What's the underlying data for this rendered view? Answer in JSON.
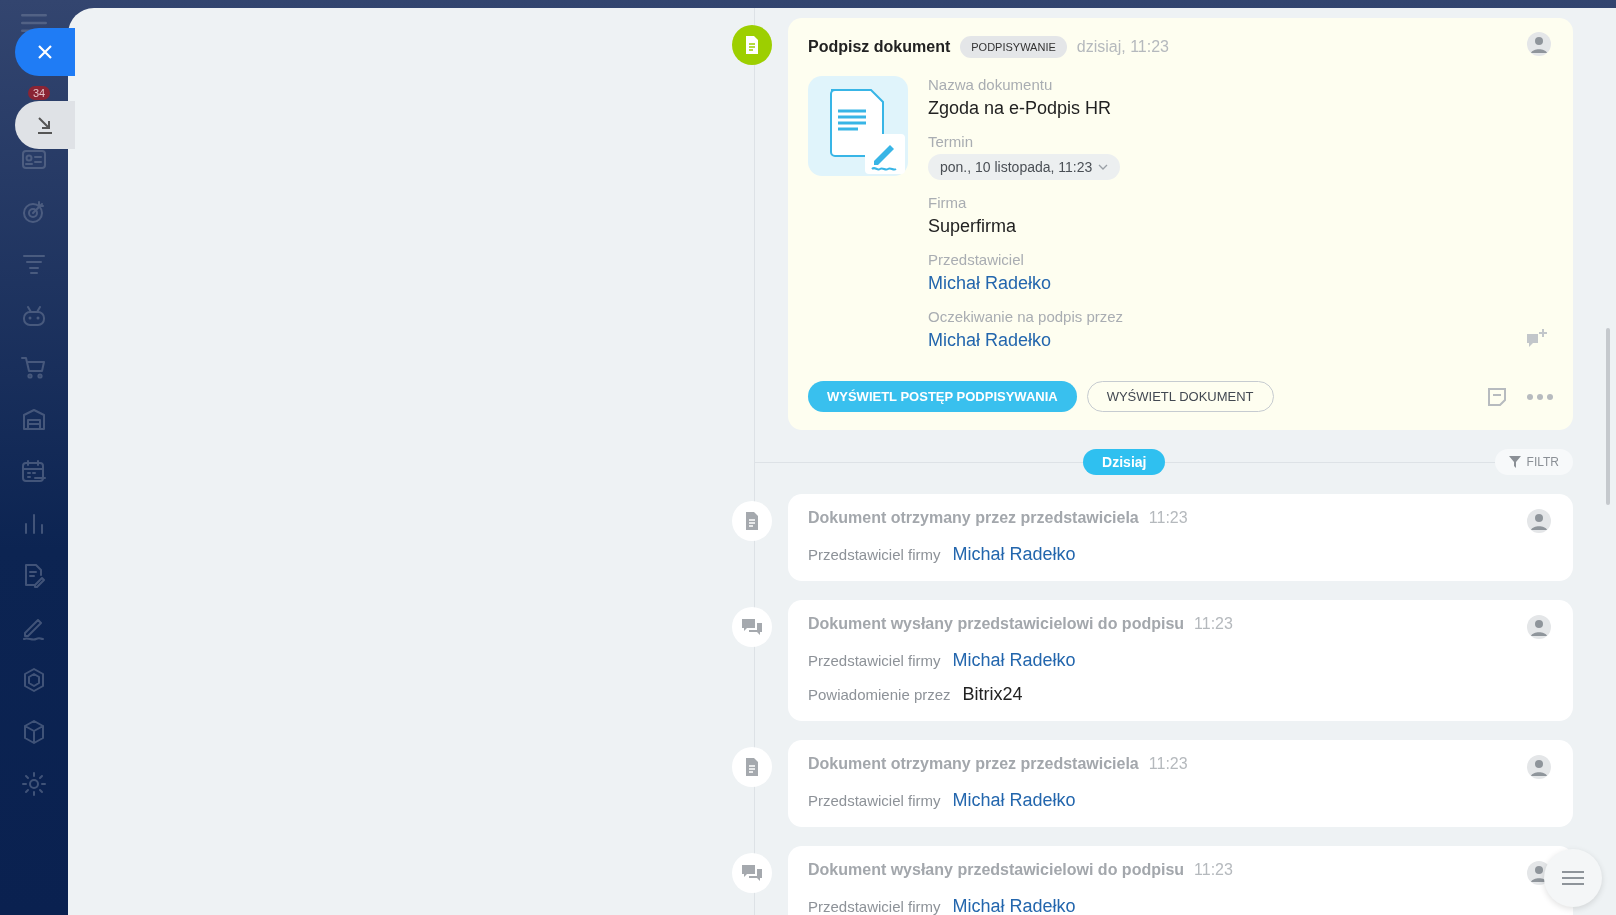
{
  "sidebar": {
    "badge": "34"
  },
  "main_card": {
    "title": "Podpisz dokument",
    "status": "PODPISYWANIE",
    "time": "dzisiaj, 11:23",
    "fields": [
      {
        "label": "Nazwa dokumentu",
        "value": "Zgoda na e-Podpis HR",
        "kind": "text"
      },
      {
        "label": "Termin",
        "value": "pon., 10 listopada, 11:23",
        "kind": "dropdown"
      },
      {
        "label": "Firma",
        "value": "Superfirma",
        "kind": "text"
      },
      {
        "label": "Przedstawiciel",
        "value": "Michał Radełko",
        "kind": "link"
      },
      {
        "label": "Oczekiwanie na podpis przez",
        "value": "Michał Radełko",
        "kind": "link"
      }
    ],
    "buttons": [
      {
        "label": "WYŚWIETL POSTĘP PODPISYWANIA",
        "kind": "primary"
      },
      {
        "label": "WYŚWIETL DOKUMENT",
        "kind": "outline"
      }
    ]
  },
  "divider": {
    "label": "Dzisiaj",
    "filter": "FILTR"
  },
  "events": [
    {
      "kind": "document",
      "title": "Dokument otrzymany przez przedstawiciela",
      "time": "11:23",
      "fields": [
        {
          "label": "Przedstawiciel firmy",
          "value": "Michał Radełko",
          "kind": "link"
        }
      ]
    },
    {
      "kind": "chat",
      "title": "Dokument wysłany przedstawicielowi do podpisu",
      "time": "11:23",
      "fields": [
        {
          "label": "Przedstawiciel firmy",
          "value": "Michał Radełko",
          "kind": "link"
        },
        {
          "label": "Powiadomienie przez",
          "value": "Bitrix24",
          "kind": "text"
        }
      ]
    },
    {
      "kind": "document",
      "title": "Dokument otrzymany przez przedstawiciela",
      "time": "11:23",
      "fields": [
        {
          "label": "Przedstawiciel firmy",
          "value": "Michał Radełko",
          "kind": "link"
        }
      ]
    },
    {
      "kind": "chat",
      "title": "Dokument wysłany przedstawicielowi do podpisu",
      "time": "11:23",
      "fields": [
        {
          "label": "Przedstawiciel firmy",
          "value": "Michał Radełko",
          "kind": "link"
        }
      ]
    }
  ]
}
